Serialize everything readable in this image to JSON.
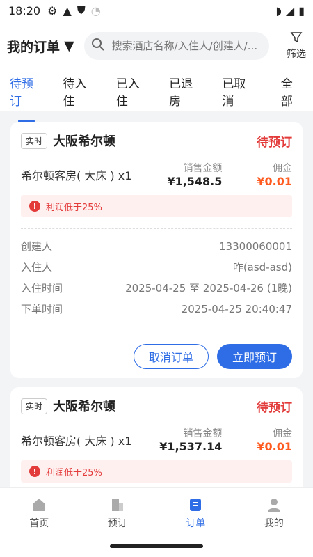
{
  "status_bar": {
    "time": "18:20",
    "icons": [
      "gear-icon",
      "warning-icon",
      "shield-icon",
      "wifi-icon"
    ],
    "right_icons": [
      "wifi-icon",
      "signal-icon",
      "battery-icon"
    ]
  },
  "header": {
    "title": "我的订单",
    "search_placeholder": "搜索酒店名称/入住人/创建人/...",
    "filter_label": "筛选"
  },
  "tabs": [
    "待预订",
    "待入住",
    "已入住",
    "已退房",
    "已取消",
    "全部"
  ],
  "active_tab": 0,
  "orders": [
    {
      "tag": "实时",
      "hotel": "大阪希尔顿",
      "status": "待预订",
      "room": "希尔顿客房( 大床 ) x1",
      "sale_label": "销售金额",
      "sale_amount": "¥1,548.5",
      "comm_label": "佣金",
      "commission": "¥0.01",
      "warning": "利润低于25%",
      "fields": [
        {
          "label": "创建人",
          "value": "13300060001"
        },
        {
          "label": "入住人",
          "value": "咋(asd-asd)"
        },
        {
          "label": "入住时间",
          "value": "2025-04-25 至 2025-04-26 (1晚)"
        },
        {
          "label": "下单时间",
          "value": "2025-04-25 20:40:47"
        }
      ],
      "cancel_label": "取消订单",
      "book_label": "立即预订"
    },
    {
      "tag": "实时",
      "hotel": "大阪希尔顿",
      "status": "待预订",
      "room": "希尔顿客房( 大床 ) x1",
      "sale_label": "销售金额",
      "sale_amount": "¥1,537.14",
      "comm_label": "佣金",
      "commission": "¥0.01",
      "warning": "利润低于25%"
    }
  ],
  "bottom_nav": [
    {
      "label": "首页",
      "icon": "home-icon"
    },
    {
      "label": "预订",
      "icon": "building-icon"
    },
    {
      "label": "订单",
      "icon": "order-icon"
    },
    {
      "label": "我的",
      "icon": "user-icon"
    }
  ],
  "colors": {
    "accent": "#2f6de6",
    "status_red": "#e33a3a",
    "commission_orange": "#ff5a1f"
  }
}
